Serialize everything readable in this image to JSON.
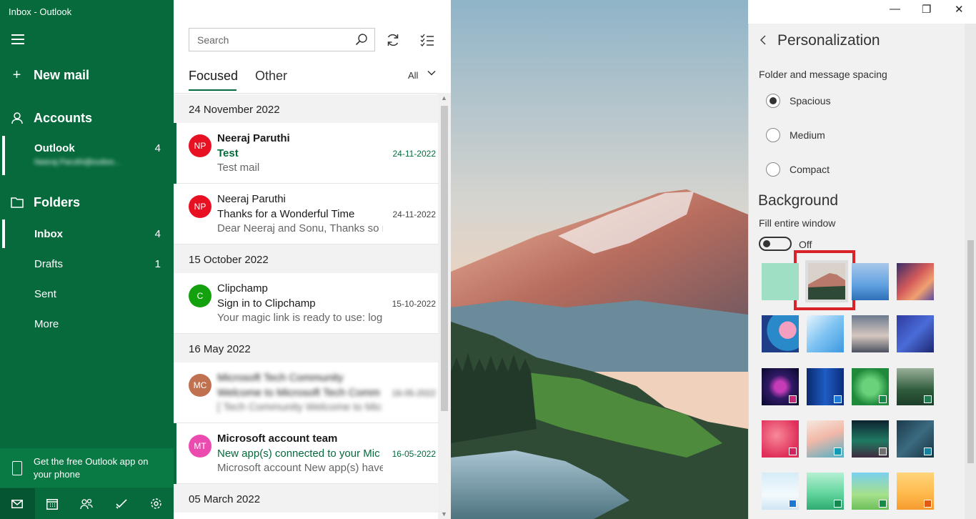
{
  "window": {
    "title": "Inbox - Outlook",
    "controls": {
      "minimize": "—",
      "restore": "❐",
      "close": "✕"
    }
  },
  "nav": {
    "new_mail": "New mail",
    "accounts": "Accounts",
    "account_name": "Outlook",
    "account_count": "4",
    "account_email": "Neeraj Paruthi@outloo...",
    "folders": "Folders",
    "folder_items": [
      {
        "label": "Inbox",
        "count": "4"
      },
      {
        "label": "Drafts",
        "count": "1"
      },
      {
        "label": "Sent",
        "count": ""
      },
      {
        "label": "More",
        "count": ""
      }
    ],
    "promo": "Get the free Outlook app on your phone",
    "bottom_icons": [
      "mail-icon",
      "calendar-icon",
      "people-icon",
      "todo-icon",
      "settings-icon"
    ]
  },
  "list": {
    "search_placeholder": "Search",
    "tab_focused": "Focused",
    "tab_other": "Other",
    "filter": "All",
    "groups": [
      "24 November 2022",
      "15 October 2022",
      "16 May 2022",
      "05 March 2022"
    ],
    "messages": [
      {
        "initials": "NP",
        "color": "#e81123",
        "sender": "Neeraj Paruthi",
        "subject": "Test",
        "preview": "Test mail",
        "date": "24-11-2022",
        "unread": true
      },
      {
        "initials": "NP",
        "color": "#e81123",
        "sender": "Neeraj Paruthi",
        "subject": "Thanks for a Wonderful Time",
        "preview": "Dear Neeraj and Sonu, Thanks so m",
        "date": "24-11-2022",
        "unread": false
      },
      {
        "initials": "C",
        "color": "#13a10e",
        "sender": "Clipchamp",
        "subject": "Sign in to Clipchamp",
        "preview": "Your magic link is ready to use: log",
        "date": "15-10-2022",
        "unread": false
      },
      {
        "initials": "MC",
        "color": "#c0714f",
        "sender": "Microsoft Tech Community",
        "subject": "Welcome to Microsoft Tech Comm",
        "preview": "[ Tech Community Welcome to Mic",
        "date": "16-05-2022",
        "unread": false
      },
      {
        "initials": "MT",
        "color": "#e3008c",
        "sender": "Microsoft account team",
        "subject": "New app(s) connected to your Mic",
        "preview": "Microsoft account New app(s) have",
        "date": "16-05-2022",
        "unread": true
      }
    ]
  },
  "personalization": {
    "title": "Personalization",
    "spacing_label": "Folder and message spacing",
    "spacing_options": [
      "Spacious",
      "Medium",
      "Compact"
    ],
    "spacing_selected": "Spacious",
    "background_title": "Background",
    "fill_label": "Fill entire window",
    "fill_state": "Off",
    "fill_on": false,
    "selected_background": 1
  }
}
